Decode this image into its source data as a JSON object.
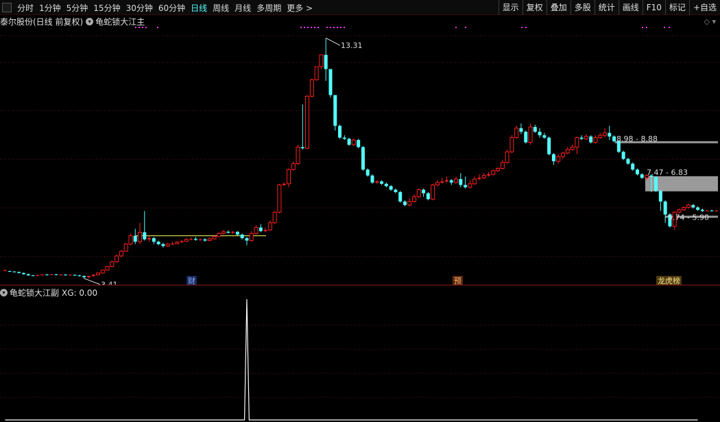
{
  "toolbar": {
    "periods": [
      "分时",
      "1分钟",
      "5分钟",
      "15分钟",
      "30分钟",
      "60分钟",
      "日线",
      "周线",
      "月线",
      "多周期",
      "更多 >"
    ],
    "active_period": "日线",
    "buttons": [
      "显示",
      "复权",
      "叠加",
      "多股",
      "统计",
      "画线",
      "F10",
      "标记",
      "+自选"
    ]
  },
  "info": {
    "stock": "泰尔股份(日线 前复权)",
    "indicator": "龟蛇锁大江主"
  },
  "sub": {
    "indicator": "龟蛇锁大江副",
    "xg_label": "XG: 0.00"
  },
  "annotations": {
    "high_label": "13.31",
    "low_label": "3.41",
    "zone1": "8.98 - 8.88",
    "zone2": "7.47 - 6.83",
    "zone3": "5.74 - 5.90",
    "tag1": "财",
    "tag2": "预",
    "tag3": "龙虎榜"
  },
  "colors": {
    "up": "#ff2020",
    "down": "#54ffff",
    "grid": "#6b1a1a",
    "zone": "#9a9a9a",
    "line": "#ffff66",
    "dots": "#ff33ff"
  },
  "chart_data": {
    "type": "candlestick",
    "ylim": [
      3.2,
      13.7
    ],
    "candles": [
      [
        3.48,
        3.5,
        3.45,
        3.52
      ],
      [
        3.46,
        3.44,
        3.42,
        3.48
      ],
      [
        3.44,
        3.42,
        3.4,
        3.46
      ],
      [
        3.42,
        3.38,
        3.36,
        3.44
      ],
      [
        3.38,
        3.33,
        3.31,
        3.4
      ],
      [
        3.33,
        3.28,
        3.26,
        3.35
      ],
      [
        3.28,
        3.26,
        3.24,
        3.3
      ],
      [
        3.26,
        3.29,
        3.24,
        3.31
      ],
      [
        3.29,
        3.31,
        3.27,
        3.33
      ],
      [
        3.31,
        3.3,
        3.28,
        3.34
      ],
      [
        3.3,
        3.32,
        3.28,
        3.34
      ],
      [
        3.32,
        3.3,
        3.28,
        3.34
      ],
      [
        3.3,
        3.31,
        3.28,
        3.33
      ],
      [
        3.31,
        3.29,
        3.27,
        3.33
      ],
      [
        3.29,
        3.3,
        3.27,
        3.32
      ],
      [
        3.3,
        3.28,
        3.26,
        3.32
      ],
      [
        3.28,
        3.25,
        3.22,
        3.3
      ],
      [
        3.25,
        3.2,
        3.15,
        3.27
      ],
      [
        3.2,
        3.25,
        3.15,
        3.27
      ],
      [
        3.25,
        3.3,
        3.22,
        3.33
      ],
      [
        3.3,
        3.38,
        3.28,
        3.4
      ],
      [
        3.38,
        3.5,
        3.36,
        3.52
      ],
      [
        3.5,
        3.65,
        3.48,
        3.68
      ],
      [
        3.65,
        3.85,
        3.62,
        3.9
      ],
      [
        3.85,
        4.1,
        3.82,
        4.15
      ],
      [
        4.1,
        4.3,
        4.05,
        4.35
      ],
      [
        4.3,
        4.6,
        4.28,
        4.65
      ],
      [
        4.6,
        4.95,
        4.55,
        5.05
      ],
      [
        4.95,
        4.7,
        4.6,
        5.25
      ],
      [
        4.7,
        5.1,
        4.6,
        5.5
      ],
      [
        5.1,
        4.8,
        4.75,
        6.0
      ],
      [
        4.8,
        4.85,
        4.7,
        4.95
      ],
      [
        4.85,
        4.7,
        4.6,
        4.9
      ],
      [
        4.7,
        4.6,
        4.55,
        4.75
      ],
      [
        4.6,
        4.52,
        4.45,
        4.65
      ],
      [
        4.52,
        4.6,
        4.48,
        4.65
      ],
      [
        4.6,
        4.62,
        4.55,
        4.7
      ],
      [
        4.62,
        4.68,
        4.6,
        4.72
      ],
      [
        4.68,
        4.72,
        4.65,
        4.78
      ],
      [
        4.72,
        4.8,
        4.7,
        4.85
      ],
      [
        4.8,
        4.82,
        4.75,
        4.88
      ],
      [
        4.82,
        4.78,
        4.74,
        4.9
      ],
      [
        4.78,
        4.8,
        4.74,
        4.85
      ],
      [
        4.8,
        4.75,
        4.7,
        4.85
      ],
      [
        4.75,
        4.82,
        4.72,
        4.88
      ],
      [
        4.82,
        4.92,
        4.8,
        4.98
      ],
      [
        4.92,
        5.05,
        4.9,
        5.1
      ],
      [
        5.05,
        5.12,
        5.0,
        5.2
      ],
      [
        5.12,
        5.08,
        5.05,
        5.18
      ],
      [
        5.08,
        5.12,
        5.02,
        5.15
      ],
      [
        5.12,
        5.0,
        4.95,
        5.15
      ],
      [
        5.0,
        4.85,
        4.8,
        5.05
      ],
      [
        4.85,
        4.75,
        4.55,
        4.9
      ],
      [
        4.75,
        5.05,
        4.7,
        5.15
      ],
      [
        5.05,
        5.3,
        5.0,
        5.4
      ],
      [
        5.3,
        5.15,
        5.1,
        5.45
      ],
      [
        5.15,
        5.2,
        5.1,
        5.3
      ],
      [
        5.2,
        5.5,
        5.15,
        5.6
      ],
      [
        5.5,
        5.95,
        5.45,
        6.0
      ],
      [
        5.95,
        7.1,
        5.9,
        7.15
      ],
      [
        7.1,
        7.15,
        7.05,
        7.2
      ],
      [
        7.15,
        7.75,
        7.0,
        7.8
      ],
      [
        7.75,
        8.0,
        7.7,
        8.1
      ],
      [
        8.0,
        8.7,
        7.95,
        8.8
      ],
      [
        8.7,
        8.65,
        8.6,
        10.5
      ],
      [
        8.65,
        10.85,
        8.6,
        10.9
      ],
      [
        10.85,
        11.55,
        10.8,
        11.6
      ],
      [
        11.55,
        12.1,
        11.5,
        12.1
      ],
      [
        12.1,
        12.6,
        12.0,
        12.6
      ],
      [
        12.6,
        12.0,
        11.5,
        13.31
      ],
      [
        12.0,
        10.9,
        10.8,
        11.1
      ],
      [
        10.9,
        9.6,
        9.4,
        10.0
      ],
      [
        9.6,
        9.1,
        9.05,
        9.65
      ],
      [
        9.1,
        9.05,
        9.0,
        9.2
      ],
      [
        9.05,
        8.8,
        8.75,
        9.1
      ],
      [
        8.8,
        9.0,
        8.75,
        9.05
      ],
      [
        9.0,
        8.7,
        8.65,
        9.05
      ],
      [
        8.7,
        7.75,
        7.7,
        8.75
      ],
      [
        7.75,
        7.5,
        7.45,
        7.8
      ],
      [
        7.5,
        7.2,
        7.15,
        7.55
      ],
      [
        7.2,
        7.25,
        7.15,
        7.3
      ],
      [
        7.25,
        7.15,
        7.1,
        7.3
      ],
      [
        7.15,
        7.05,
        7.0,
        7.2
      ],
      [
        7.05,
        6.9,
        6.85,
        7.1
      ],
      [
        6.9,
        6.8,
        6.75,
        6.95
      ],
      [
        6.8,
        6.4,
        6.35,
        6.85
      ],
      [
        6.4,
        6.25,
        6.2,
        6.45
      ],
      [
        6.25,
        6.4,
        6.2,
        6.55
      ],
      [
        6.4,
        6.6,
        6.35,
        6.7
      ],
      [
        6.6,
        6.9,
        6.55,
        6.95
      ],
      [
        6.9,
        6.75,
        6.6,
        6.95
      ],
      [
        6.75,
        6.5,
        6.45,
        6.8
      ],
      [
        6.5,
        7.1,
        6.45,
        7.15
      ],
      [
        7.1,
        7.2,
        7.05,
        7.3
      ],
      [
        7.2,
        7.25,
        7.15,
        7.4
      ],
      [
        7.25,
        7.3,
        7.2,
        7.45
      ],
      [
        7.3,
        7.2,
        7.1,
        7.35
      ],
      [
        7.2,
        7.35,
        7.15,
        7.45
      ],
      [
        7.35,
        7.1,
        7.0,
        7.6
      ],
      [
        7.1,
        7.0,
        6.95,
        7.45
      ],
      [
        7.0,
        7.15,
        6.95,
        7.3
      ],
      [
        7.15,
        7.35,
        7.1,
        7.45
      ],
      [
        7.35,
        7.4,
        7.3,
        7.55
      ],
      [
        7.4,
        7.5,
        7.35,
        7.6
      ],
      [
        7.5,
        7.55,
        7.45,
        7.65
      ],
      [
        7.55,
        7.7,
        7.5,
        7.75
      ],
      [
        7.7,
        7.8,
        7.65,
        7.85
      ],
      [
        7.8,
        8.05,
        7.75,
        8.15
      ],
      [
        8.05,
        8.5,
        8.0,
        8.6
      ],
      [
        8.5,
        9.1,
        8.45,
        9.2
      ],
      [
        9.1,
        9.5,
        9.05,
        9.6
      ],
      [
        9.5,
        9.35,
        9.25,
        9.7
      ],
      [
        9.35,
        8.9,
        8.85,
        9.4
      ],
      [
        8.9,
        9.55,
        8.8,
        9.7
      ],
      [
        9.55,
        9.35,
        9.3,
        9.65
      ],
      [
        9.35,
        9.2,
        9.1,
        9.5
      ],
      [
        9.2,
        9.1,
        9.05,
        9.3
      ],
      [
        9.1,
        8.4,
        8.35,
        9.15
      ],
      [
        8.4,
        8.1,
        7.95,
        8.45
      ],
      [
        8.1,
        8.3,
        8.0,
        8.4
      ],
      [
        8.3,
        8.45,
        8.2,
        8.5
      ],
      [
        8.45,
        8.6,
        8.4,
        8.7
      ],
      [
        8.6,
        8.7,
        8.55,
        8.8
      ],
      [
        8.7,
        9.1,
        8.4,
        9.15
      ],
      [
        9.1,
        9.05,
        9.0,
        9.2
      ],
      [
        9.05,
        9.15,
        9.0,
        9.25
      ],
      [
        9.15,
        8.9,
        8.85,
        9.2
      ],
      [
        8.9,
        9.1,
        8.85,
        9.2
      ],
      [
        9.1,
        9.2,
        9.05,
        9.3
      ],
      [
        9.2,
        9.3,
        9.1,
        9.5
      ],
      [
        9.3,
        9.15,
        9.0,
        9.6
      ],
      [
        9.15,
        8.95,
        8.9,
        9.2
      ],
      [
        8.95,
        8.5,
        8.45,
        9.0
      ],
      [
        8.5,
        8.2,
        8.15,
        8.55
      ],
      [
        8.2,
        8.0,
        7.95,
        8.25
      ],
      [
        8.0,
        7.75,
        7.7,
        8.05
      ],
      [
        7.75,
        7.55,
        7.5,
        7.8
      ],
      [
        7.55,
        7.4,
        7.35,
        7.6
      ],
      [
        7.4,
        7.5,
        7.3,
        7.55
      ],
      [
        7.5,
        7.45,
        6.8,
        7.55
      ],
      [
        7.45,
        6.85,
        6.8,
        7.1
      ],
      [
        6.85,
        6.4,
        6.0,
        6.9
      ],
      [
        6.4,
        5.85,
        5.5,
        6.45
      ],
      [
        5.85,
        5.35,
        5.3,
        5.9
      ],
      [
        5.35,
        5.95,
        5.2,
        6.0
      ],
      [
        5.95,
        6.05,
        5.9,
        6.1
      ],
      [
        6.05,
        6.15,
        6.0,
        6.2
      ],
      [
        6.15,
        6.25,
        6.1,
        6.3
      ],
      [
        6.25,
        6.15,
        6.1,
        6.3
      ],
      [
        6.15,
        6.05,
        6.0,
        6.2
      ],
      [
        6.05,
        6.0,
        5.95,
        6.1
      ],
      [
        6.0,
        6.02,
        5.98,
        6.05
      ],
      [
        6.02,
        6.0,
        5.98,
        6.05
      ],
      [
        6.0,
        6.01,
        5.98,
        6.04
      ]
    ],
    "signal": [
      0,
      0,
      0,
      0,
      0,
      0,
      0,
      0,
      0,
      0,
      0,
      0,
      0,
      0,
      0,
      0,
      0,
      0,
      0,
      0,
      0,
      0,
      0,
      0,
      0,
      0,
      0,
      0,
      0,
      0,
      0,
      0,
      0,
      0,
      0,
      0,
      0,
      0,
      0,
      0,
      0,
      0,
      0,
      0,
      0,
      0,
      0,
      0,
      0,
      0,
      0,
      0,
      1,
      0,
      0,
      0,
      0,
      0,
      0,
      0,
      0,
      0,
      0,
      0,
      0,
      0,
      0,
      0,
      0,
      0,
      0,
      0,
      0,
      0,
      0,
      0,
      0,
      0,
      0,
      0,
      0,
      0,
      0,
      0,
      0,
      0,
      0,
      0,
      0,
      0,
      0,
      0,
      0,
      0,
      0,
      0,
      0,
      0,
      0,
      0,
      0,
      0,
      0,
      0,
      0,
      0,
      0,
      0,
      0,
      0,
      0,
      0,
      0,
      0,
      0,
      0,
      0,
      0,
      0,
      0,
      0,
      0,
      0,
      0,
      0,
      0,
      0,
      0,
      0,
      0,
      0,
      0,
      0,
      0,
      0,
      0,
      0,
      0,
      0,
      0,
      0,
      0,
      0,
      0,
      0,
      0,
      0,
      0,
      0,
      0
    ]
  }
}
